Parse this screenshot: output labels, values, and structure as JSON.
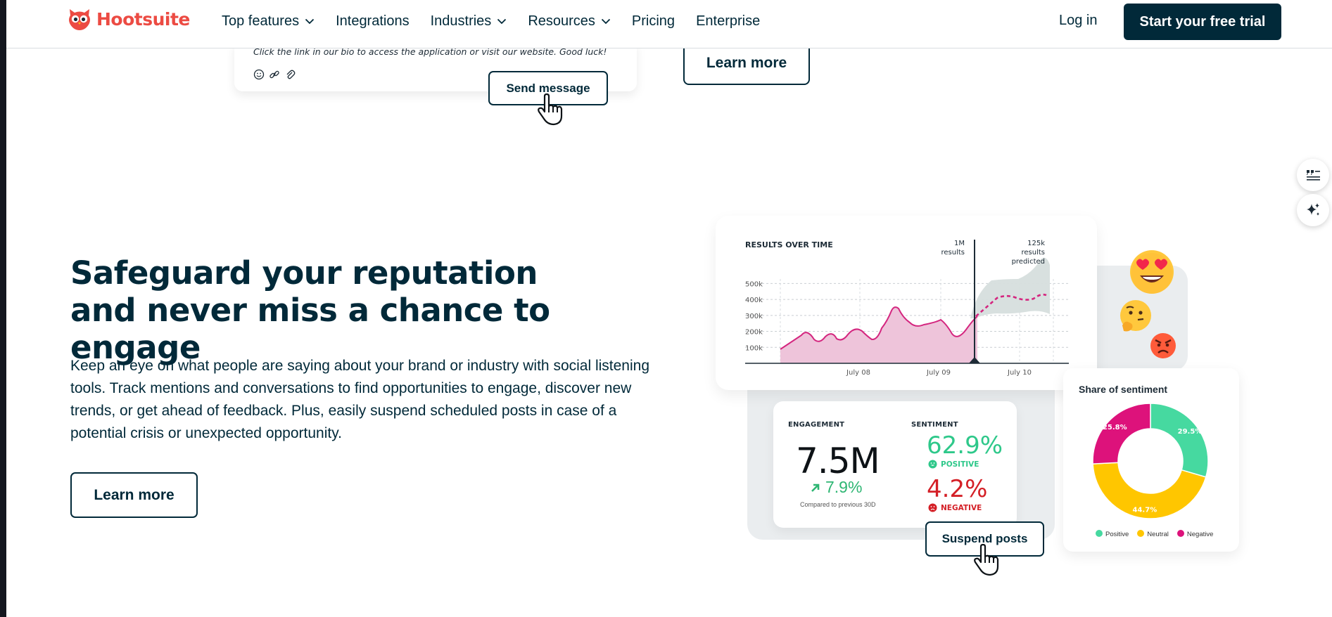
{
  "brand": {
    "name": "Hootsuite",
    "logo_icon": "owl-logo-icon",
    "accent": "#ec4b43",
    "dark": "#012939"
  },
  "nav": {
    "items": [
      {
        "label": "Top features",
        "has_dropdown": true
      },
      {
        "label": "Integrations",
        "has_dropdown": false
      },
      {
        "label": "Industries",
        "has_dropdown": true
      },
      {
        "label": "Resources",
        "has_dropdown": true
      },
      {
        "label": "Pricing",
        "has_dropdown": false
      },
      {
        "label": "Enterprise",
        "has_dropdown": false
      }
    ],
    "login": "Log in",
    "cta": "Start your free trial"
  },
  "previous_section": {
    "message_text": "Click the link in our bio to access the application or visit our website. Good luck!",
    "send_button": "Send message",
    "learn_more": "Learn more"
  },
  "section": {
    "headline": "Safeguard your reputation and never miss a chance to engage",
    "paragraph": "Keep an eye on what people are saying about your brand or industry with social listening tools. Track mentions and conversations to find opportunities to engage, discover new trends, or get ahead of feedback. Plus, easily suspend scheduled posts in case of a potential crisis or unexpected opportunity.",
    "learn_more": "Learn more"
  },
  "side_widgets": [
    {
      "icon": "quote-list-icon"
    },
    {
      "icon": "sparkles-icon"
    }
  ],
  "results_chart": {
    "title": "RESULTS OVER TIME",
    "marker_label": [
      "1M",
      "results"
    ],
    "prediction_label": [
      "125k",
      "results",
      "predicted"
    ],
    "y_ticks": [
      "500k",
      "400k",
      "300k",
      "200k",
      "100k"
    ],
    "x_ticks": [
      "July 08",
      "July 09",
      "July 10"
    ]
  },
  "metrics": {
    "engagement_label": "ENGAGEMENT",
    "engagement_value": "7.5M",
    "engagement_change": "7.9%",
    "compare_text": "Compared to previous 30D",
    "sentiment_label": "SENTIMENT",
    "positive_value": "62.9%",
    "positive_label": "POSITIVE",
    "negative_value": "4.2%",
    "negative_label": "NEGATIVE",
    "colors": {
      "positive": "#2ec88a",
      "negative": "#d41f26",
      "up": "#2eb673"
    }
  },
  "suspend_button": "Suspend posts",
  "share": {
    "title": "Share of sentiment",
    "legend": [
      "Positive",
      "Neutral",
      "Negative"
    ]
  },
  "chart_data": [
    {
      "type": "area",
      "title": "RESULTS OVER TIME",
      "x": [
        "July 08",
        "July 09",
        "July 10"
      ],
      "ylim": [
        0,
        550000
      ],
      "y_ticks": [
        100000,
        200000,
        300000,
        400000,
        500000
      ],
      "series": [],
      "annotations": [
        "1M results",
        "125k results predicted"
      ],
      "colors": {
        "actual": "#eec4da",
        "actual_line": "#d4267f",
        "prediction_band": "#d6dedd",
        "prediction_line": "#d4267f"
      }
    },
    {
      "type": "pie",
      "title": "Share of sentiment",
      "categories": [
        "Positive",
        "Neutral",
        "Negative"
      ],
      "values": [
        29.5,
        44.7,
        25.8
      ],
      "labels": [
        "29.5%",
        "44.7%",
        "25.8%"
      ],
      "colors": [
        "#46d9a0",
        "#ffc600",
        "#dd127b"
      ]
    }
  ]
}
